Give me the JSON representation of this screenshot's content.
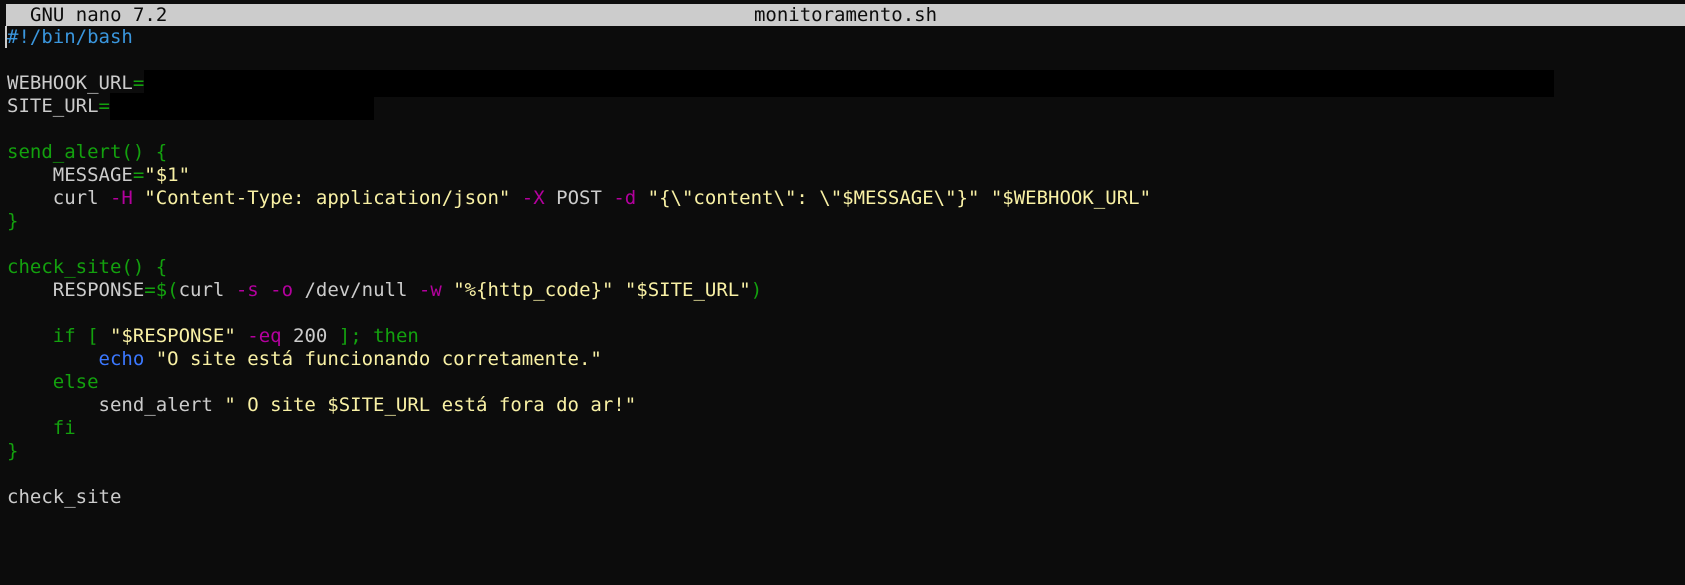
{
  "titlebar": {
    "app": "GNU nano 7.2",
    "filename": "monitoramento.sh"
  },
  "colors": {
    "background": "#0c0c0c",
    "default_text": "#cccccc",
    "shebang": "#3a96dd",
    "keyword_green": "#13a10e",
    "string_yellow": "#f9f1a5",
    "option_magenta": "#b4009e",
    "builtin_blue": "#3b78ff"
  },
  "lines": [
    [
      {
        "t": "#",
        "c": "cursor"
      },
      {
        "t": "!/bin/bash",
        "c": "shebang"
      }
    ],
    [],
    [
      {
        "t": "WEBHOOK_URL",
        "c": "def"
      },
      {
        "t": "=",
        "c": "green"
      },
      {
        "redact": 1410
      }
    ],
    [
      {
        "t": "SITE_URL",
        "c": "def"
      },
      {
        "t": "=",
        "c": "green"
      },
      {
        "redact": 264
      }
    ],
    [],
    [
      {
        "t": "send_alert() {",
        "c": "green"
      }
    ],
    [
      {
        "t": "    MESSAGE",
        "c": "def"
      },
      {
        "t": "=",
        "c": "green"
      },
      {
        "t": "\"$1\"",
        "c": "str"
      }
    ],
    [
      {
        "t": "    curl ",
        "c": "def"
      },
      {
        "t": "-H",
        "c": "opt"
      },
      {
        "t": " ",
        "c": "def"
      },
      {
        "t": "\"Content-Type: application/json\"",
        "c": "str"
      },
      {
        "t": " ",
        "c": "def"
      },
      {
        "t": "-X",
        "c": "opt"
      },
      {
        "t": " POST ",
        "c": "def"
      },
      {
        "t": "-d",
        "c": "opt"
      },
      {
        "t": " ",
        "c": "def"
      },
      {
        "t": "\"{\\\"content\\\": \\\"$MESSAGE\\\"}\"",
        "c": "str"
      },
      {
        "t": " ",
        "c": "def"
      },
      {
        "t": "\"$WEBHOOK_URL\"",
        "c": "str"
      }
    ],
    [
      {
        "t": "}",
        "c": "green"
      }
    ],
    [],
    [
      {
        "t": "check_site() {",
        "c": "green"
      }
    ],
    [
      {
        "t": "    RESPONSE",
        "c": "def"
      },
      {
        "t": "=$(",
        "c": "green"
      },
      {
        "t": "curl ",
        "c": "def"
      },
      {
        "t": "-s",
        "c": "opt"
      },
      {
        "t": " ",
        "c": "def"
      },
      {
        "t": "-o",
        "c": "opt"
      },
      {
        "t": " /dev/null ",
        "c": "def"
      },
      {
        "t": "-w",
        "c": "opt"
      },
      {
        "t": " ",
        "c": "def"
      },
      {
        "t": "\"%{http_code}\"",
        "c": "str"
      },
      {
        "t": " ",
        "c": "def"
      },
      {
        "t": "\"$SITE_URL\"",
        "c": "str"
      },
      {
        "t": ")",
        "c": "green"
      }
    ],
    [],
    [
      {
        "t": "    if [ ",
        "c": "green"
      },
      {
        "t": "\"$RESPONSE\"",
        "c": "str"
      },
      {
        "t": " ",
        "c": "def"
      },
      {
        "t": "-eq",
        "c": "opt"
      },
      {
        "t": " 200 ",
        "c": "def"
      },
      {
        "t": "]; then",
        "c": "green"
      }
    ],
    [
      {
        "t": "        ",
        "c": "def"
      },
      {
        "t": "echo",
        "c": "blue"
      },
      {
        "t": " ",
        "c": "def"
      },
      {
        "t": "\"O site está funcionando corretamente.\"",
        "c": "str"
      }
    ],
    [
      {
        "t": "    else",
        "c": "green"
      }
    ],
    [
      {
        "t": "        send_alert ",
        "c": "def"
      },
      {
        "t": "\" O site $SITE_URL está fora do ar!\"",
        "c": "str"
      }
    ],
    [
      {
        "t": "    fi",
        "c": "green"
      }
    ],
    [
      {
        "t": "}",
        "c": "green"
      }
    ],
    [],
    [
      {
        "t": "check_site",
        "c": "def"
      }
    ]
  ]
}
